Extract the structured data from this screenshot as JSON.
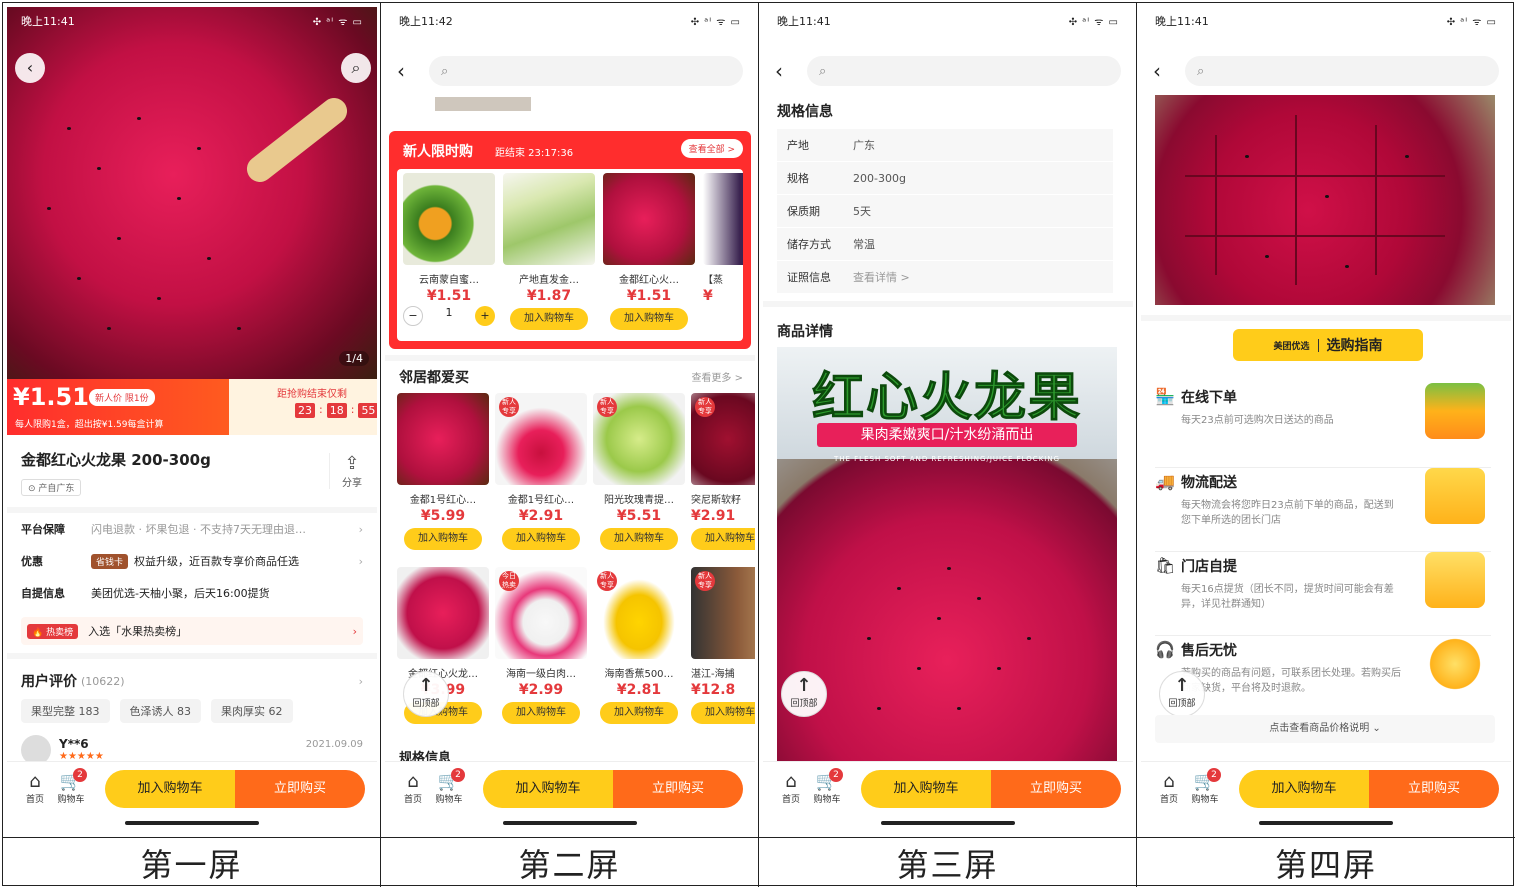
{
  "captions": [
    "第一屏",
    "第二屏",
    "第三屏",
    "第四屏"
  ],
  "status_times": [
    "晚上11:41",
    "晚上11:42",
    "晚上11:41",
    "晚上11:41"
  ],
  "status_right": "✣ ᵃᴵ ᯤ ▭",
  "common": {
    "home": "首页",
    "cart": "购物车",
    "cart_badge": "2",
    "add_cart": "加入购物车",
    "buy_now": "立即购买",
    "back_top": "回顶部"
  },
  "s1": {
    "page_indicator": "1/4",
    "price": "¥1.51",
    "new_tag": "新人价 限1份",
    "limit_text": "每人限购1盒，超出按¥1.59每盒计算",
    "countdown_label": "距抢购结束仅剩",
    "countdown": [
      "23",
      "18",
      "55"
    ],
    "title": "金都红心火龙果 200-300g",
    "origin": "产自广东",
    "share": "分享",
    "guarantee_label": "平台保障",
    "guarantee_text": "闪电退款 · 坏果包退 · 不支持7天无理由退…",
    "discount_label": "优惠",
    "discount_badge": "省钱卡",
    "discount_text": "权益升级，近百款专享价商品任选",
    "pickup_label": "自提信息",
    "pickup_text": "美团优选-天柚小聚，后天16:00提货",
    "hot_badge": "热卖榜",
    "hot_text": "入选「水果热卖榜」",
    "review_label": "用户评价",
    "review_count": "(10622)",
    "review_tags": [
      "果型完整 183",
      "色泽诱人 83",
      "果肉厚实 62"
    ],
    "reviewer": "Y**6",
    "review_date": "2021.09.09"
  },
  "s2": {
    "flash_title": "新人限时购",
    "flash_timer": "距结束 23:17:36",
    "flash_all": "查看全部 >",
    "flash_items": [
      {
        "name": "云南蒙自蜜…",
        "price": "¥1.51"
      },
      {
        "name": "产地直发金…",
        "price": "¥1.87"
      },
      {
        "name": "金都红心火…",
        "price": "¥1.51"
      },
      {
        "name": "【蒸",
        "price": "¥"
      }
    ],
    "qty": "1",
    "neighbors_title": "邻居都爱买",
    "neighbors_more": "查看更多 >",
    "row1": [
      {
        "name": "金都1号红心…",
        "price": "¥5.99"
      },
      {
        "name": "金都1号红心…",
        "price": "¥2.91"
      },
      {
        "name": "阳光玫瑰青提…",
        "price": "¥5.51"
      },
      {
        "name": "突尼斯软籽",
        "price": "¥2.91"
      }
    ],
    "row2": [
      {
        "name": "金都红心火龙…",
        "price": "¥3.99"
      },
      {
        "name": "海南一级白肉…",
        "price": "¥2.99"
      },
      {
        "name": "海南香蕉500…",
        "price": "¥2.81"
      },
      {
        "name": "湛江-海捕",
        "price": "¥12.8"
      }
    ],
    "new_tag": "新人专享",
    "today_tag": "今日热卖",
    "spec_title": "规格信息"
  },
  "s3": {
    "spec_title": "规格信息",
    "specs": [
      {
        "k": "产地",
        "v": "广东"
      },
      {
        "k": "规格",
        "v": "200-300g"
      },
      {
        "k": "保质期",
        "v": "5天"
      },
      {
        "k": "储存方式",
        "v": "常温"
      },
      {
        "k": "证照信息",
        "v": "查看详情 >"
      }
    ],
    "detail_title": "商品详情",
    "banner_title": "红心火龙果",
    "banner_sub": "果肉柔嫩爽口/汁水纷涌而出",
    "banner_en": "THE FLESH SOFT AND REFRESHING/JUICE FLOCKING"
  },
  "s4": {
    "guide_brand": "美团优选",
    "guide_title": "选购指南",
    "services": [
      {
        "icon": "🏪",
        "title": "在线下单",
        "desc": "每天23点前可选购次日送达的商品"
      },
      {
        "icon": "🚚",
        "title": "物流配送",
        "desc": "每天物流会将您昨日23点前下单的商品，配送到您下单所选的团长门店"
      },
      {
        "icon": "🛍",
        "title": "门店自提",
        "desc": "每天16点提货（团长不同，提货时间可能会有差异，详见社群通知）"
      },
      {
        "icon": "🎧",
        "title": "售后无忧",
        "desc": "若购买的商品有问题，可联系团长处理。若购买后商家缺货，平台将及时退款。"
      }
    ],
    "price_note": "点击查看商品价格说明 ⌄"
  }
}
